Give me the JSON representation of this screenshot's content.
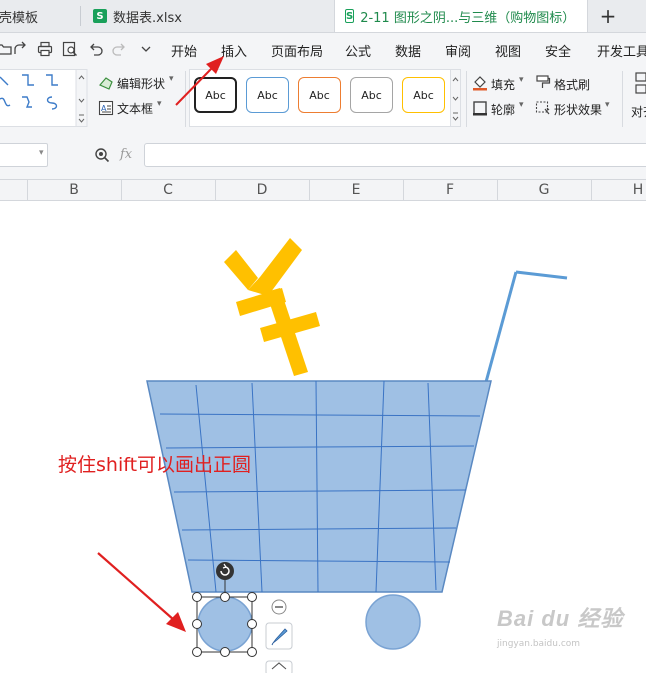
{
  "tabs": [
    {
      "label": "稻壳模板",
      "active": false
    },
    {
      "label": "数据表.xlsx",
      "active": false
    },
    {
      "label": "2-11 图形之阴...与三维（购物图标）",
      "active": true
    }
  ],
  "new_tab_symbol": "+",
  "menu": {
    "items": [
      "开始",
      "插入",
      "页面布局",
      "公式",
      "数据",
      "审阅",
      "视图",
      "安全",
      "开发工具"
    ],
    "active": "插入"
  },
  "ribbon": {
    "edit_shape": "编辑形状",
    "text_box": "文本框",
    "style_samples": [
      "Abc",
      "Abc",
      "Abc",
      "Abc",
      "Abc"
    ],
    "style_colors": [
      "#222222",
      "#5b9bd5",
      "#ed7d31",
      "#a5a5a5",
      "#ffc000"
    ],
    "fill": "填充",
    "format_painter": "格式刷",
    "outline": "轮廓",
    "shape_effects": "形状效果",
    "align_partial": "对齐"
  },
  "formula_bar": {
    "fx_label": "fx",
    "value": ""
  },
  "columns": [
    "B",
    "C",
    "D",
    "E",
    "F",
    "G",
    "H"
  ],
  "annotation": "按住shift可以画出正圆",
  "watermark": {
    "main": "Bai du 经验",
    "sub": "jingyan.baidu.com"
  },
  "colors": {
    "cart_fill": "#9fc0e4",
    "cart_stroke": "#5a89c2",
    "yen": "#ffc000",
    "arrow": "#e02020",
    "active_tab_text": "#1f8a4c"
  }
}
